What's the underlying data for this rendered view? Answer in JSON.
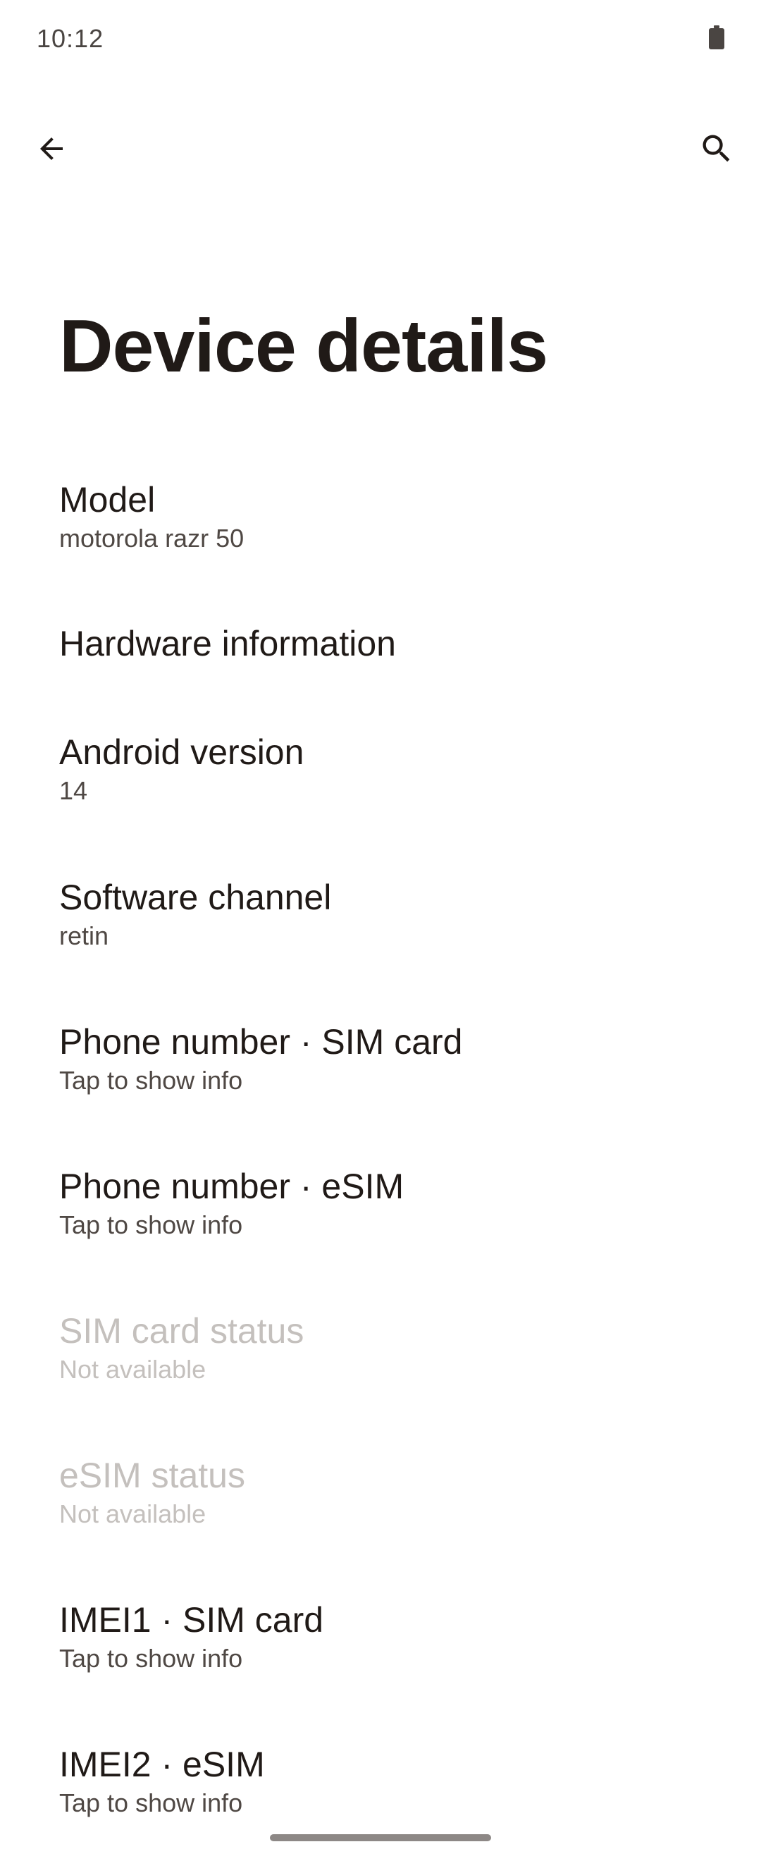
{
  "status_bar": {
    "time": "10:12",
    "battery_icon": "battery-full-icon"
  },
  "app_bar": {
    "back_icon": "arrow-left-icon",
    "search_icon": "search-icon"
  },
  "page": {
    "title": "Device details"
  },
  "items": [
    {
      "title": "Model",
      "summary": "motorola razr 50",
      "enabled": true
    },
    {
      "title": "Hardware information",
      "summary": "",
      "enabled": true
    },
    {
      "title": "Android version",
      "summary": "14",
      "enabled": true
    },
    {
      "title": "Software channel",
      "summary": "retin",
      "enabled": true
    },
    {
      "title": "Phone number · SIM card",
      "summary": "Tap to show info",
      "enabled": true
    },
    {
      "title": "Phone number · eSIM",
      "summary": "Tap to show info",
      "enabled": true
    },
    {
      "title": "SIM card status",
      "summary": "Not available",
      "enabled": false
    },
    {
      "title": "eSIM status",
      "summary": "Not available",
      "enabled": false
    },
    {
      "title": "IMEI1 · SIM card",
      "summary": "Tap to show info",
      "enabled": true
    },
    {
      "title": "IMEI2 · eSIM",
      "summary": "Tap to show info",
      "enabled": true
    }
  ],
  "colors": {
    "text_primary": "#201a17",
    "text_secondary": "#4f4844",
    "text_disabled": "#c4c0bd",
    "background": "#ffffff"
  }
}
